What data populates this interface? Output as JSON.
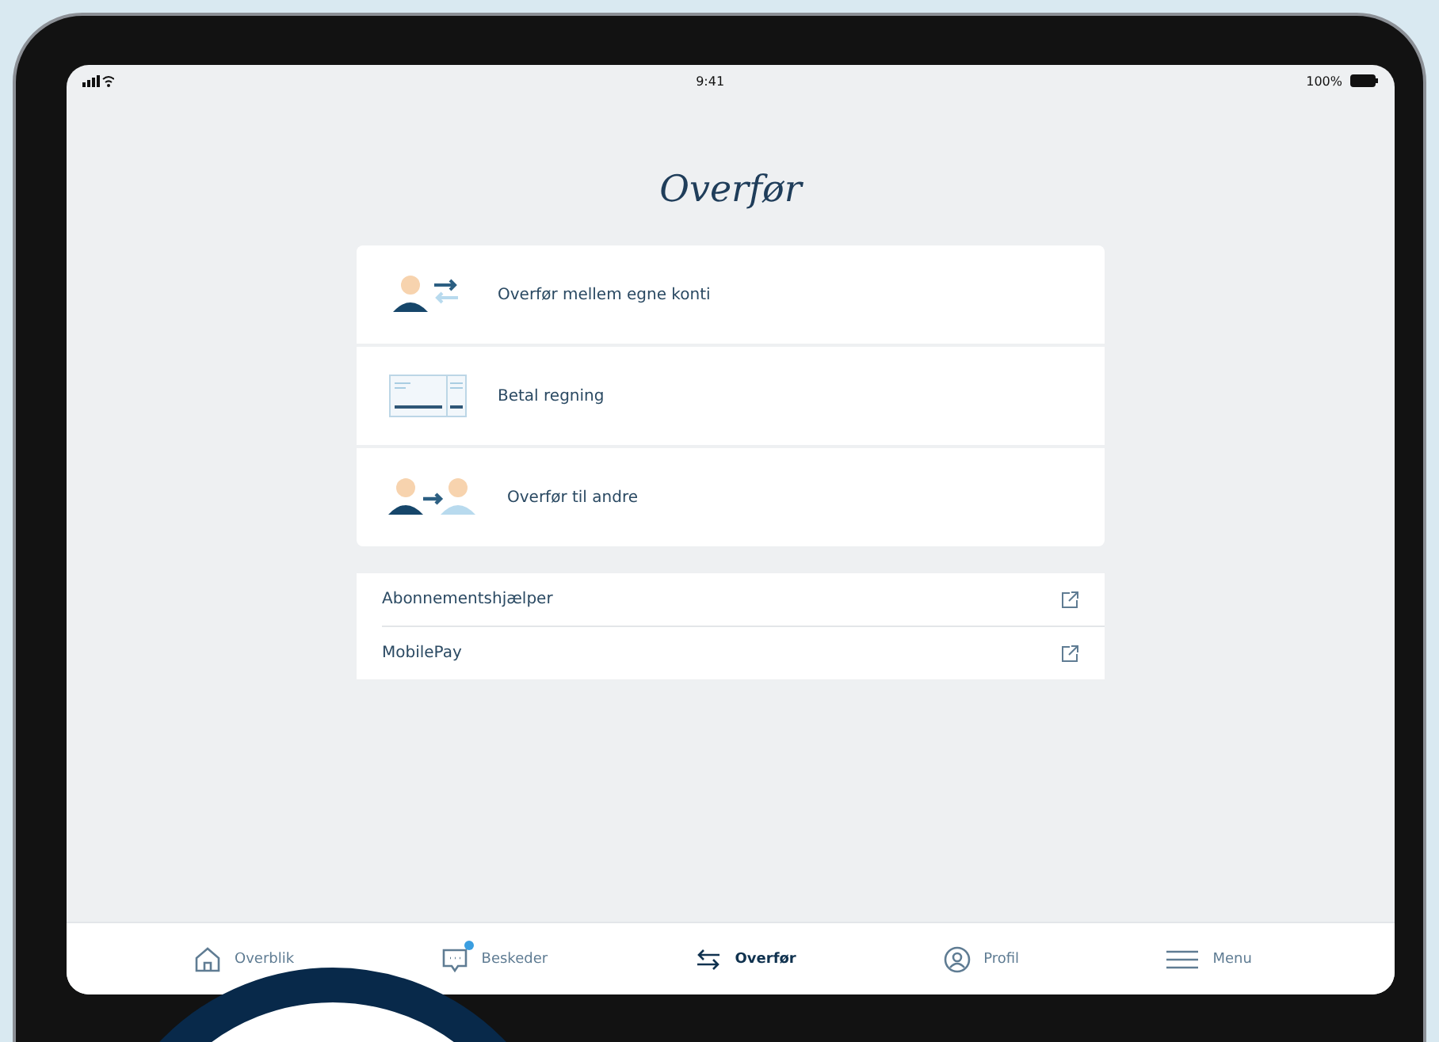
{
  "status_bar": {
    "time": "9:41",
    "battery": "100%"
  },
  "title": "Overfør",
  "actions": [
    {
      "label": "Overfør mellem egne konti",
      "kind": "own"
    },
    {
      "label": "Betal regning",
      "kind": "bill"
    },
    {
      "label": "Overfør til andre",
      "kind": "others"
    }
  ],
  "links": [
    {
      "label": "Abonnementshjælper"
    },
    {
      "label": "MobilePay"
    }
  ],
  "tab_bar": [
    {
      "label": "Overblik",
      "kind": "home",
      "selected": false,
      "notification": false
    },
    {
      "label": "Beskeder",
      "kind": "messages",
      "selected": false,
      "notification": true
    },
    {
      "label": "Overfør",
      "kind": "transfer",
      "selected": true,
      "notification": false
    },
    {
      "label": "Profil",
      "kind": "profile",
      "selected": false,
      "notification": false
    },
    {
      "label": "Menu",
      "kind": "menu",
      "selected": false,
      "notification": false
    }
  ]
}
